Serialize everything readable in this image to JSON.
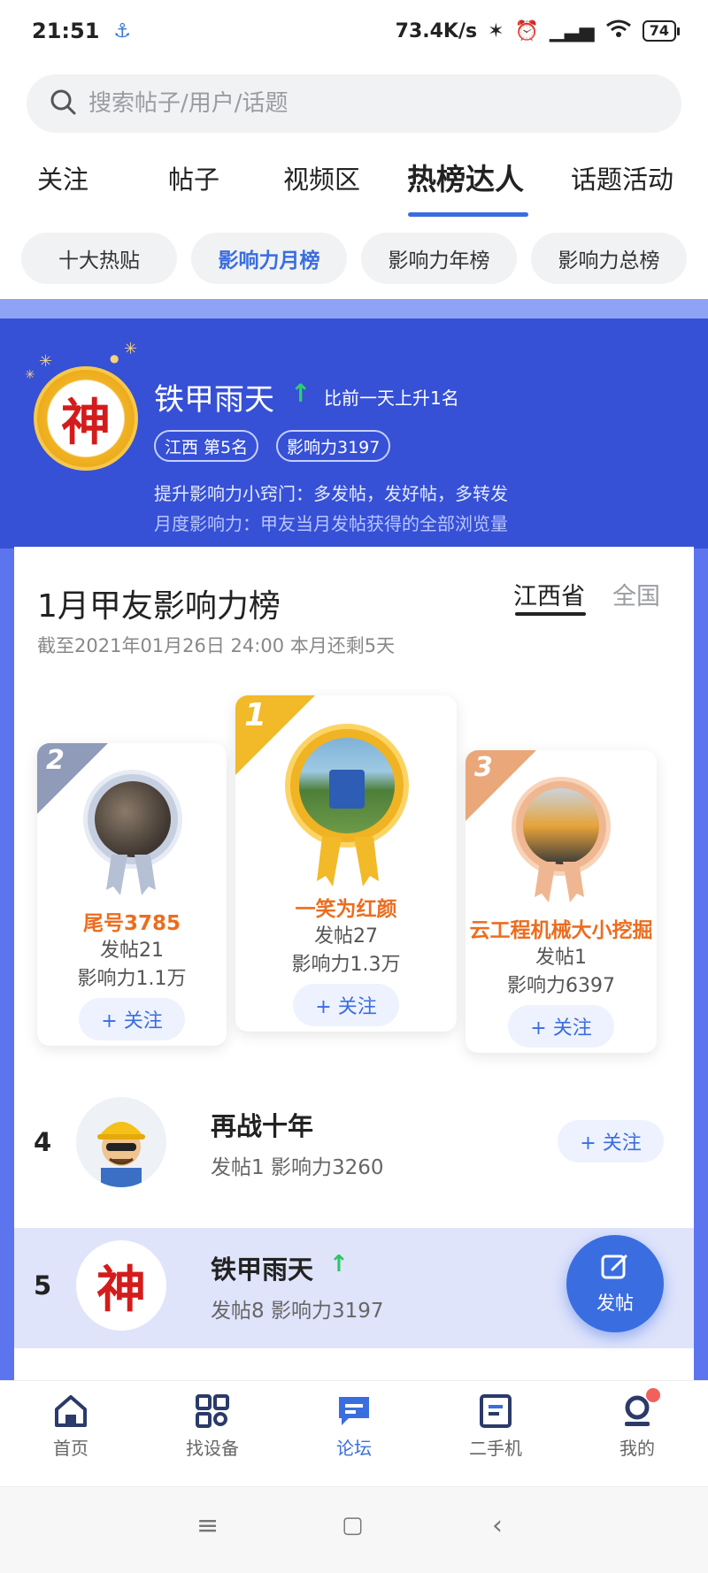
{
  "status_bar": {
    "time": "21:51",
    "speed": "73.4K/s",
    "battery": "74"
  },
  "search": {
    "placeholder": "搜索帖子/用户/话题"
  },
  "tabs": [
    {
      "label": "关注"
    },
    {
      "label": "帖子"
    },
    {
      "label": "视频区"
    },
    {
      "label": "热榜达人"
    },
    {
      "label": "话题活动"
    }
  ],
  "chips": [
    {
      "label": "十大热贴"
    },
    {
      "label": "影响力月榜"
    },
    {
      "label": "影响力年榜"
    },
    {
      "label": "影响力总榜"
    }
  ],
  "me": {
    "avatar_char": "神",
    "name": "铁甲雨天",
    "rank_change": "比前一天上升1名",
    "region_rank": "江西  第5名",
    "influence": "影响力3197",
    "tip1": "提升影响力小窍门：多发帖，发好帖，多转发",
    "tip2": "月度影响力：甲友当月发帖获得的全部浏览量"
  },
  "board": {
    "title": "1月甲友影响力榜",
    "region_active": "江西省",
    "region_other": "全国",
    "subtitle": "截至2021年01月26日 24:00 本月还剩5天"
  },
  "podium": [
    {
      "rank": "2",
      "name": "尾号3785",
      "posts": "发帖21",
      "influence": "影响力1.1万",
      "follow": "+ 关注"
    },
    {
      "rank": "1",
      "name": "一笑为红颜",
      "posts": "发帖27",
      "influence": "影响力1.3万",
      "follow": "+ 关注"
    },
    {
      "rank": "3",
      "name": "云工程机械大小挖掘",
      "posts": "发帖1",
      "influence": "影响力6397",
      "follow": "+ 关注"
    }
  ],
  "rows": [
    {
      "rank": "4",
      "name": "再战十年",
      "stats": "发帖1    影响力3260",
      "follow": "+ 关注"
    },
    {
      "rank": "5",
      "name": "铁甲雨天",
      "stats": "发帖8    影响力3197",
      "avatar_char": "神"
    }
  ],
  "fab": {
    "label": "发帖"
  },
  "bottom_nav": [
    {
      "label": "首页"
    },
    {
      "label": "找设备"
    },
    {
      "label": "论坛"
    },
    {
      "label": "二手机"
    },
    {
      "label": "我的"
    }
  ],
  "colors": {
    "accent": "#3a6de0",
    "banner": "#3650d6",
    "up_green": "#2bd16a",
    "gold": "#f0b323",
    "silver": "#9aa7c4",
    "bronze": "#e8a070"
  }
}
